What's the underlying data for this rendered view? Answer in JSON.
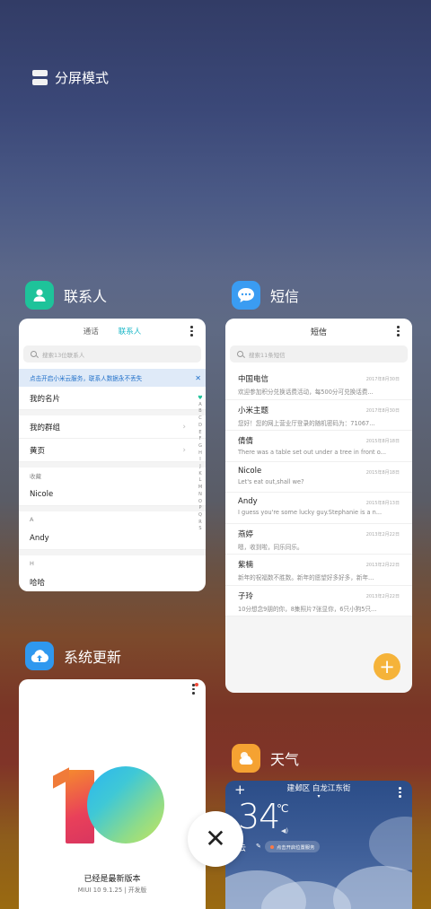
{
  "split_screen": {
    "label": "分屏模式"
  },
  "apps": {
    "contacts": {
      "name": "联系人",
      "icon": "person-icon",
      "color": "#1ec39a"
    },
    "messages": {
      "name": "短信",
      "icon": "chat-bubble-icon",
      "color": "#3a9cf2"
    },
    "updater": {
      "name": "系统更新",
      "icon": "cloud-upload-icon",
      "color": "#2f98ef"
    },
    "weather": {
      "name": "天气",
      "icon": "sun-cloud-icon",
      "color": "#f5a232"
    }
  },
  "contacts_card": {
    "tabs": [
      "通话",
      "联系人"
    ],
    "search_placeholder": "搜索13位联系人",
    "banner": "点击开启小米云服务，联系人数据永不丢失",
    "banner_close": "✕",
    "rows": {
      "my_card": "我的名片",
      "my_groups": "我的群组",
      "yellow_pages": "黄页",
      "favorites_header": "收藏",
      "nicole": "Nicole",
      "section_a": "A",
      "andy": "Andy",
      "section_h": "H",
      "haha": "哈哈"
    },
    "alphabet": [
      "A",
      "B",
      "C",
      "D",
      "E",
      "F",
      "G",
      "H",
      "I",
      "J",
      "K",
      "L",
      "M",
      "N",
      "O",
      "P",
      "Q",
      "R",
      "S"
    ]
  },
  "messages_card": {
    "title": "短信",
    "search_placeholder": "搜索11条短信",
    "items": [
      {
        "name": "中国电信",
        "date": "2017年8月30日",
        "preview": "欢迎参加积分兑换话费活动，每500分可兑换话费..."
      },
      {
        "name": "小米主题",
        "date": "2017年8月30日",
        "preview": "您好！您的网上营业厅登录的随机密码为：71067..."
      },
      {
        "name": "倩倩",
        "date": "2015年8月18日",
        "preview": "There was a table set out under a tree in front o..."
      },
      {
        "name": "Nicole",
        "date": "2015年8月18日",
        "preview": "Let's eat out,shall we?"
      },
      {
        "name": "Andy",
        "date": "2015年8月13日",
        "preview": "I guess you're some lucky guy.Stephanie is a n..."
      },
      {
        "name": "燕婷",
        "date": "2013年2月22日",
        "preview": "嗯，收到啦，同乐同乐。"
      },
      {
        "name": "紫楠",
        "date": "2013年2月22日",
        "preview": "新年的祝福数不胜数。新年的愿望好多好多，新年..."
      },
      {
        "name": "子玲",
        "date": "2013年2月22日",
        "preview": "10分想念9朋的你，8集照片7张显你，6只小狗5只..."
      }
    ],
    "fab": "+"
  },
  "update_card": {
    "status": "已经是最新版本",
    "version": "MIUI 10 9.1.25 | 开发版"
  },
  "weather_card": {
    "location": "建邺区 白龙江东街",
    "temperature": "34",
    "unit": "℃",
    "condition": "云",
    "tag": "点击开启位置服务"
  },
  "close_button": "✕"
}
